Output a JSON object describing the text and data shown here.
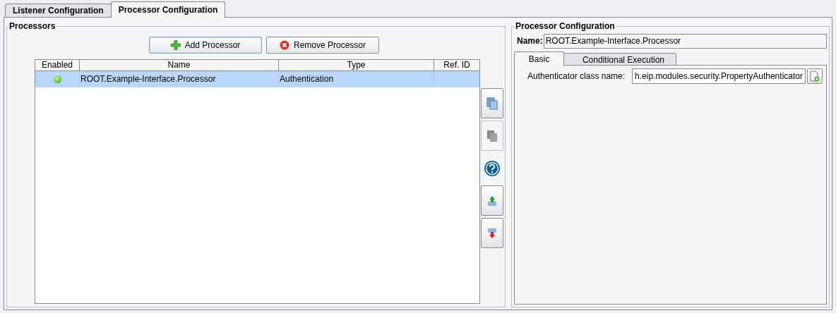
{
  "tabs": [
    {
      "label": "Listener Configuration",
      "selected": false
    },
    {
      "label": "Processor Configuration",
      "selected": true
    }
  ],
  "processors": {
    "title": "Processors",
    "buttons": [
      {
        "kind": "add",
        "label": "Add Processor"
      },
      {
        "kind": "remove",
        "label": "Remove Processor"
      }
    ],
    "table": {
      "columns": [
        "Enabled",
        "Name",
        "Type",
        "Ref. ID"
      ],
      "rows": [
        {
          "enabled": true,
          "name": "ROOT.Example-Interface.Processor",
          "type": "Authentication",
          "selected": true
        }
      ]
    },
    "side_buttons": [
      {
        "kind": "copy",
        "disabled": false
      },
      {
        "kind": "paste",
        "disabled": true
      },
      {
        "kind": "help",
        "disabled": false
      },
      {
        "kind": "up",
        "disabled": false
      },
      {
        "kind": "down",
        "disabled": false
      }
    ]
  },
  "config": {
    "title": "Processor Configuration",
    "name_label": "Name:",
    "name_value": "ROOT.Example-Interface.Processor",
    "tabs": [
      {
        "label": "Basic",
        "selected": true
      },
      {
        "label": "Conditional Execution",
        "selected": false
      }
    ],
    "field_label": "Authenticator class name:",
    "field_value": "h.eip.modules.security.PropertyAuthenticator"
  }
}
